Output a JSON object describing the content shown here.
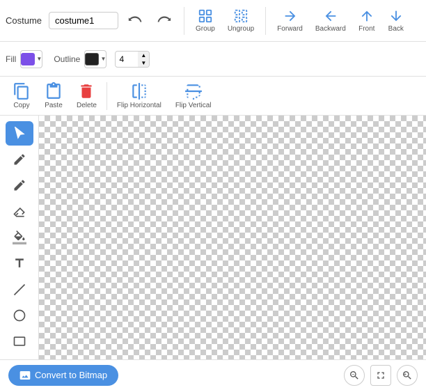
{
  "top_bar": {
    "costume_label": "Costume",
    "costume_name": "costume1",
    "undo_label": "Undo",
    "redo_label": "Redo",
    "group_label": "Group",
    "ungroup_label": "Ungroup",
    "forward_label": "Forward",
    "backward_label": "Backward",
    "front_label": "Front",
    "back_label": "Back"
  },
  "second_bar": {
    "fill_label": "Fill",
    "outline_label": "Outline",
    "outline_value": "4"
  },
  "action_bar": {
    "copy_label": "Copy",
    "paste_label": "Paste",
    "delete_label": "Delete",
    "flip_horizontal_label": "Flip Horizontal",
    "flip_vertical_label": "Flip Vertical"
  },
  "tools": {
    "select_label": "Select",
    "reshape_label": "Reshape",
    "pencil_label": "Pencil",
    "eraser_label": "Eraser",
    "fill_label": "Fill",
    "text_label": "Text",
    "line_label": "Line",
    "circle_label": "Circle",
    "rect_label": "Rectangle"
  },
  "bottom_bar": {
    "convert_label": "Convert to Bitmap",
    "zoom_in_label": "Zoom In",
    "zoom_reset_label": "Zoom Reset",
    "zoom_out_label": "Zoom Out"
  }
}
